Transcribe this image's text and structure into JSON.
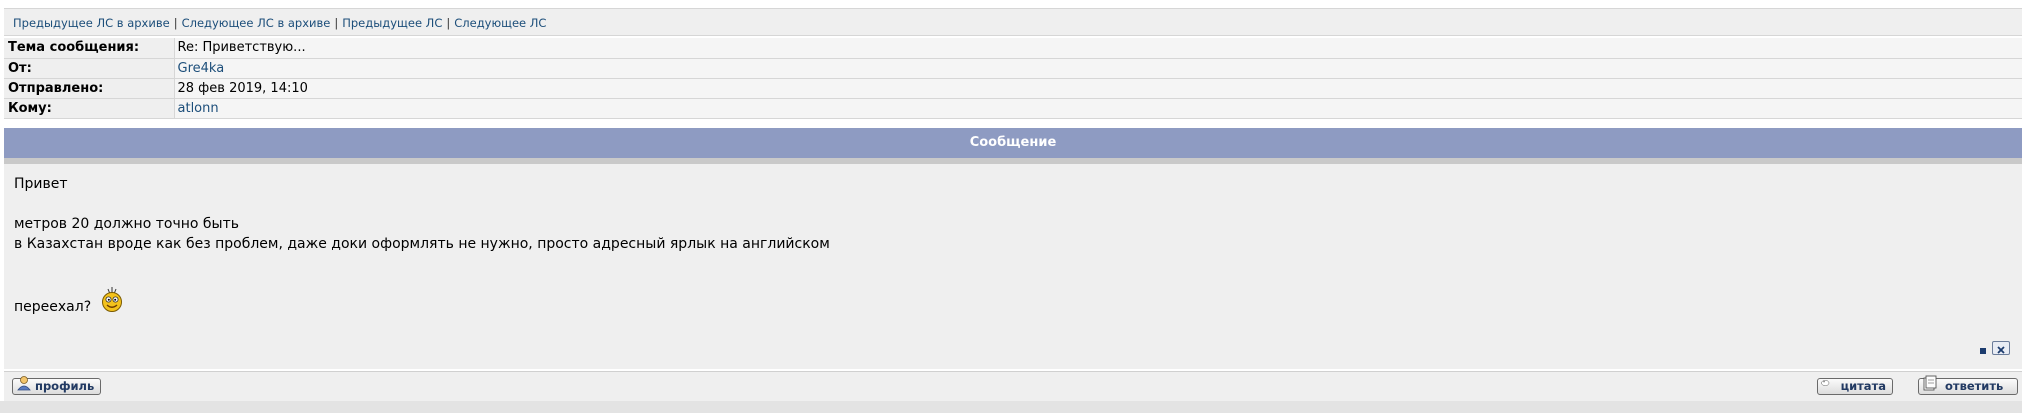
{
  "nav": {
    "prev_archive": "Предыдущее ЛС в архиве",
    "next_archive": "Следующее ЛС в архиве",
    "prev": "Предыдущее ЛС",
    "next": "Следующее ЛС",
    "separator": "|"
  },
  "header": {
    "subject_label": "Тема сообщения:",
    "subject_value": "Re: Приветствую...",
    "from_label": "От:",
    "from_value": "Gre4ka",
    "sent_label": "Отправлено:",
    "sent_value": "28 фев 2019, 14:10",
    "to_label": "Кому:",
    "to_value": "atlonn"
  },
  "message": {
    "title": "Сообщение",
    "line1": "Привет",
    "line2": "метров 20 должно точно быть",
    "line3": "в Казахстан вроде как без проблем, даже доки оформлять не нужно, просто адресный ярлык на английском",
    "line4": "переехал?",
    "smiley_icon": "smiley-icon"
  },
  "buttons": {
    "profile": "профиль",
    "quote": "цитата",
    "reply": "ответить"
  },
  "colors": {
    "title_bar": "#8e9bc2",
    "link": "#1c4e7a",
    "panel": "#efefef"
  }
}
